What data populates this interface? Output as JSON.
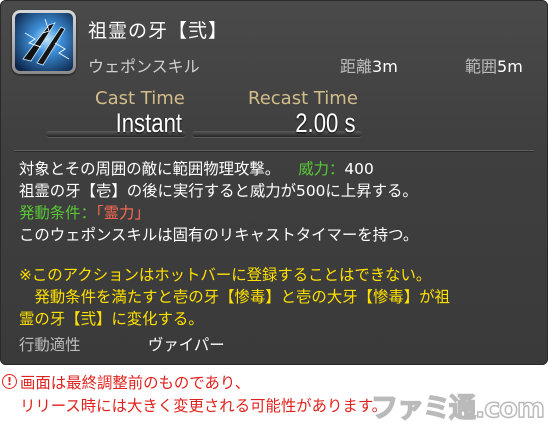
{
  "skill": {
    "name": "祖霊の牙【弐】",
    "type": "ウェポンスキル",
    "icon": "serpent-fang-icon",
    "range_label": "距離",
    "range_value": "3m",
    "radius_label": "範囲",
    "radius_value": "5m"
  },
  "timing": {
    "cast_label": "Cast Time",
    "cast_value": "Instant",
    "recast_label": "Recast Time",
    "recast_value": "2.00 s"
  },
  "description": {
    "line1": "対象とその周囲の敵に範囲物理攻撃。",
    "potency_label": "威力：",
    "potency_value": "400",
    "line2": "祖霊の牙【壱】の後に実行すると威力が500に上昇する。",
    "condition_label": "発動条件：",
    "condition_value": "「霊力」",
    "line4": "このウェポンスキルは固有のリキャストタイマーを持つ。",
    "note1": "※このアクションはホットバーに登録することはできない。",
    "note2": "　発動条件を満たすと壱の牙【惨毒】と壱の大牙【惨毒】が祖",
    "note3": "霊の牙【弐】に変化する。"
  },
  "properties": {
    "job_label": "行動適性",
    "job_value": "ヴァイパー"
  },
  "notice": {
    "icon": "exclamation-circle-icon",
    "line1": "画面は最終調整前のものであり、",
    "line2": "リリース時には大きく変更される可能性があります。"
  },
  "watermark": "ファミ通.com",
  "colors": {
    "cast_labels": "#d3bd8a",
    "green_text": "#58c738",
    "red_text": "#ff6a52",
    "yellow_text": "#ffe000",
    "notice_text": "#e0221e"
  }
}
